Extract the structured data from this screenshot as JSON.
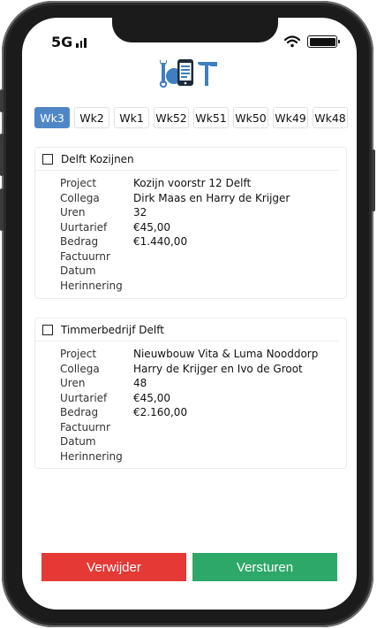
{
  "status": {
    "carrier": "5G"
  },
  "tabs": [
    "Wk3",
    "Wk2",
    "Wk1",
    "Wk52",
    "Wk51",
    "Wk50",
    "Wk49",
    "Wk48"
  ],
  "active_tab": "Wk3",
  "field_labels": {
    "project": "Project",
    "collega": "Collega",
    "uren": "Uren",
    "uurtarief": "Uurtarief",
    "bedrag": "Bedrag",
    "factuurnr": "Factuurnr",
    "datum": "Datum",
    "herinnering": "Herinnering"
  },
  "entries": [
    {
      "client": "Delft Kozijnen",
      "project": "Kozijn voorstr 12 Delft",
      "collega": "Dirk Maas en Harry de Krijger",
      "uren": "32",
      "uurtarief": "€45,00",
      "bedrag": "€1.440,00",
      "factuurnr": "",
      "datum": "",
      "herinnering": ""
    },
    {
      "client": "Timmerbedrijf Delft",
      "project": "Nieuwbouw Vita & Luma Nooddorp",
      "collega": "Harry de Krijger en Ivo de Groot",
      "uren": "48",
      "uurtarief": "€45,00",
      "bedrag": "€2.160,00",
      "factuurnr": "",
      "datum": "",
      "herinnering": ""
    }
  ],
  "buttons": {
    "delete": "Verwijder",
    "send": "Versturen"
  },
  "colors": {
    "accent": "#4f86c6",
    "delete": "#e53935",
    "send": "#2ea869"
  }
}
